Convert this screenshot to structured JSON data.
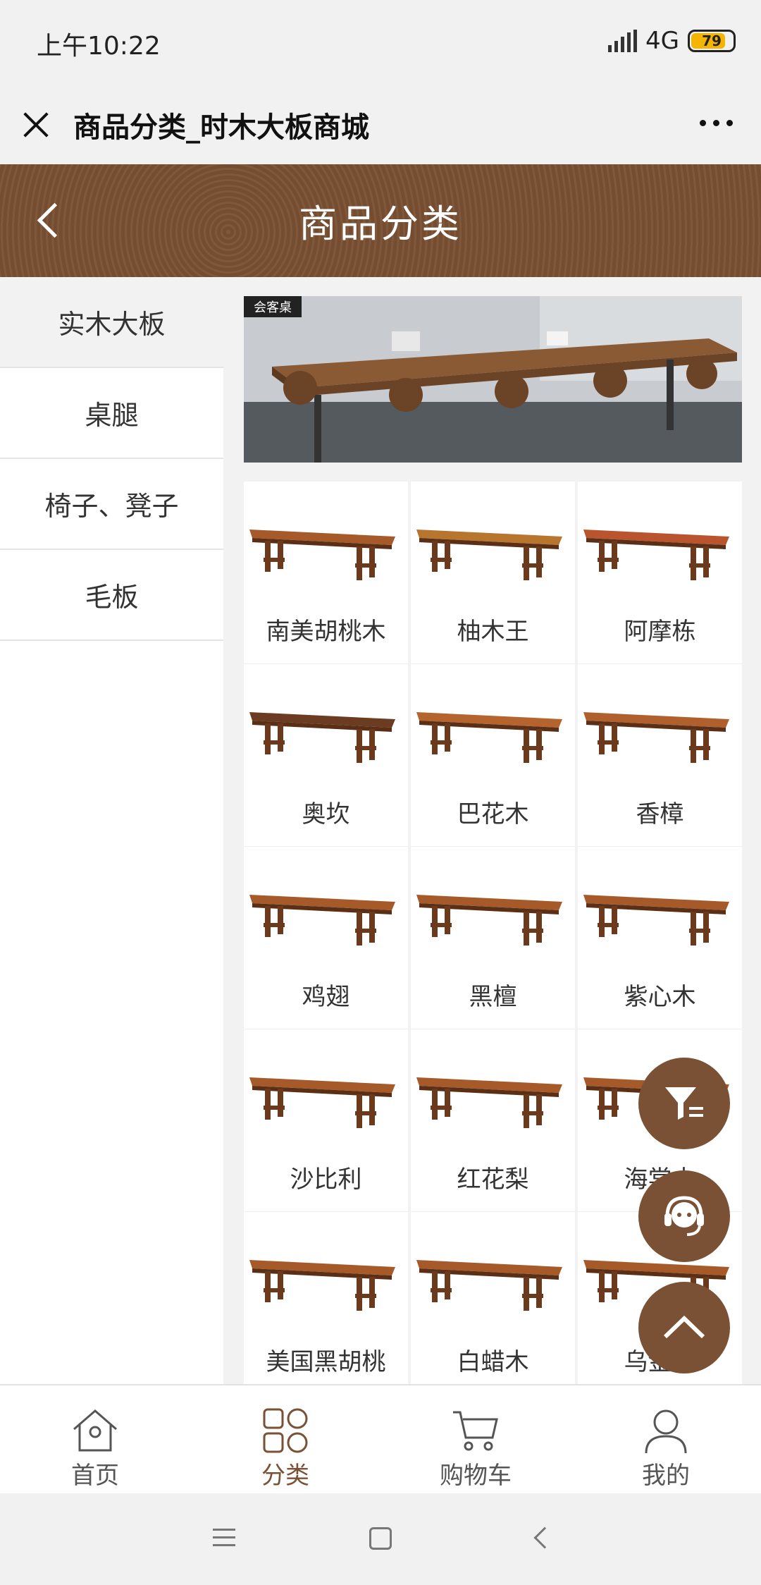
{
  "status_bar": {
    "time": "上午10:22",
    "network": "4G",
    "battery": "79"
  },
  "title_bar": {
    "title": "商品分类_时木大板商城"
  },
  "header": {
    "title": "商品分类"
  },
  "sidebar": {
    "items": [
      {
        "label": "实木大板",
        "active": true
      },
      {
        "label": "桌腿",
        "active": false
      },
      {
        "label": "椅子、凳子",
        "active": false
      },
      {
        "label": "毛板",
        "active": false
      }
    ]
  },
  "banner": {
    "tag": "会客桌"
  },
  "products": [
    {
      "label": "南美胡桃木",
      "color": "#a65a2a"
    },
    {
      "label": "柚木王",
      "color": "#b8752e"
    },
    {
      "label": "阿摩栋",
      "color": "#b9542f"
    },
    {
      "label": "奥坎",
      "color": "#6b3b22"
    },
    {
      "label": "巴花木",
      "color": "#b5642e"
    },
    {
      "label": "香樟",
      "color": "#b0602c"
    },
    {
      "label": "鸡翅",
      "color": "#a65a2a"
    },
    {
      "label": "黑檀",
      "color": "#a65a2a"
    },
    {
      "label": "紫心木",
      "color": "#a65a2a"
    },
    {
      "label": "沙比利",
      "color": "#a65a2a"
    },
    {
      "label": "红花梨",
      "color": "#a65a2a"
    },
    {
      "label": "海棠木",
      "color": "#a65a2a"
    },
    {
      "label": "美国黑胡桃",
      "color": "#a65a2a"
    },
    {
      "label": "白蜡木",
      "color": "#a65a2a"
    },
    {
      "label": "乌金木",
      "color": "#a65a2a"
    }
  ],
  "bottom_nav": {
    "items": [
      {
        "label": "首页",
        "icon": "home-icon"
      },
      {
        "label": "分类",
        "icon": "category-icon"
      },
      {
        "label": "购物车",
        "icon": "cart-icon"
      },
      {
        "label": "我的",
        "icon": "user-icon"
      }
    ]
  },
  "theme": {
    "accent": "#7a5134"
  }
}
